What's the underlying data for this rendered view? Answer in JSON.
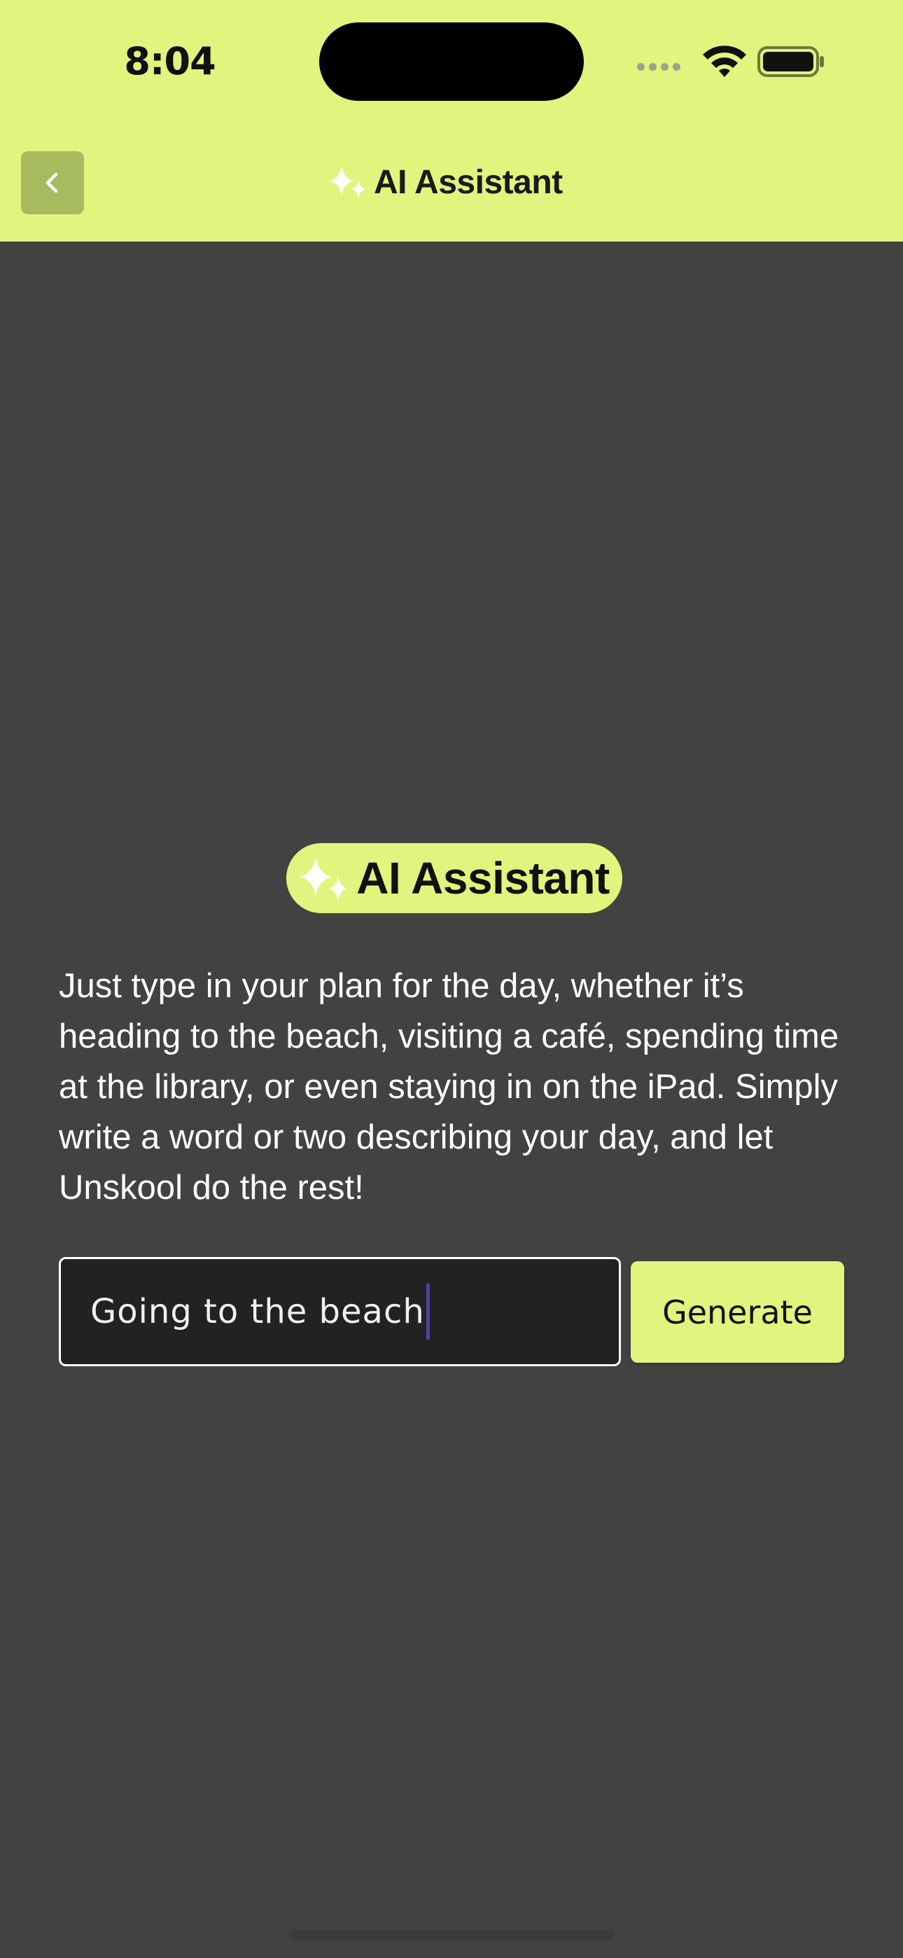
{
  "status_bar": {
    "time": "8:04",
    "icons": [
      "signal-dots-icon",
      "wifi-icon",
      "battery-icon"
    ]
  },
  "header": {
    "back_icon": "chevron-left-icon",
    "title": "AI Assistant",
    "title_icon": "sparkles-icon"
  },
  "main": {
    "badge": {
      "icon": "sparkles-icon",
      "label": "AI Assistant"
    },
    "description": "Just type in your plan for the day, whether it’s heading to the beach, visiting a café, spending time at the library, or even staying in on the iPad. Simply write a word or two describing your day, and let Unskool do the rest!",
    "plan_input": {
      "value": "Going to the beach"
    },
    "generate_label": "Generate"
  },
  "colors": {
    "accent": "#e0f47e",
    "background": "#424242",
    "back_button": "#a8ba5e",
    "input_background": "#222222",
    "caret": "#5b3fa0"
  }
}
